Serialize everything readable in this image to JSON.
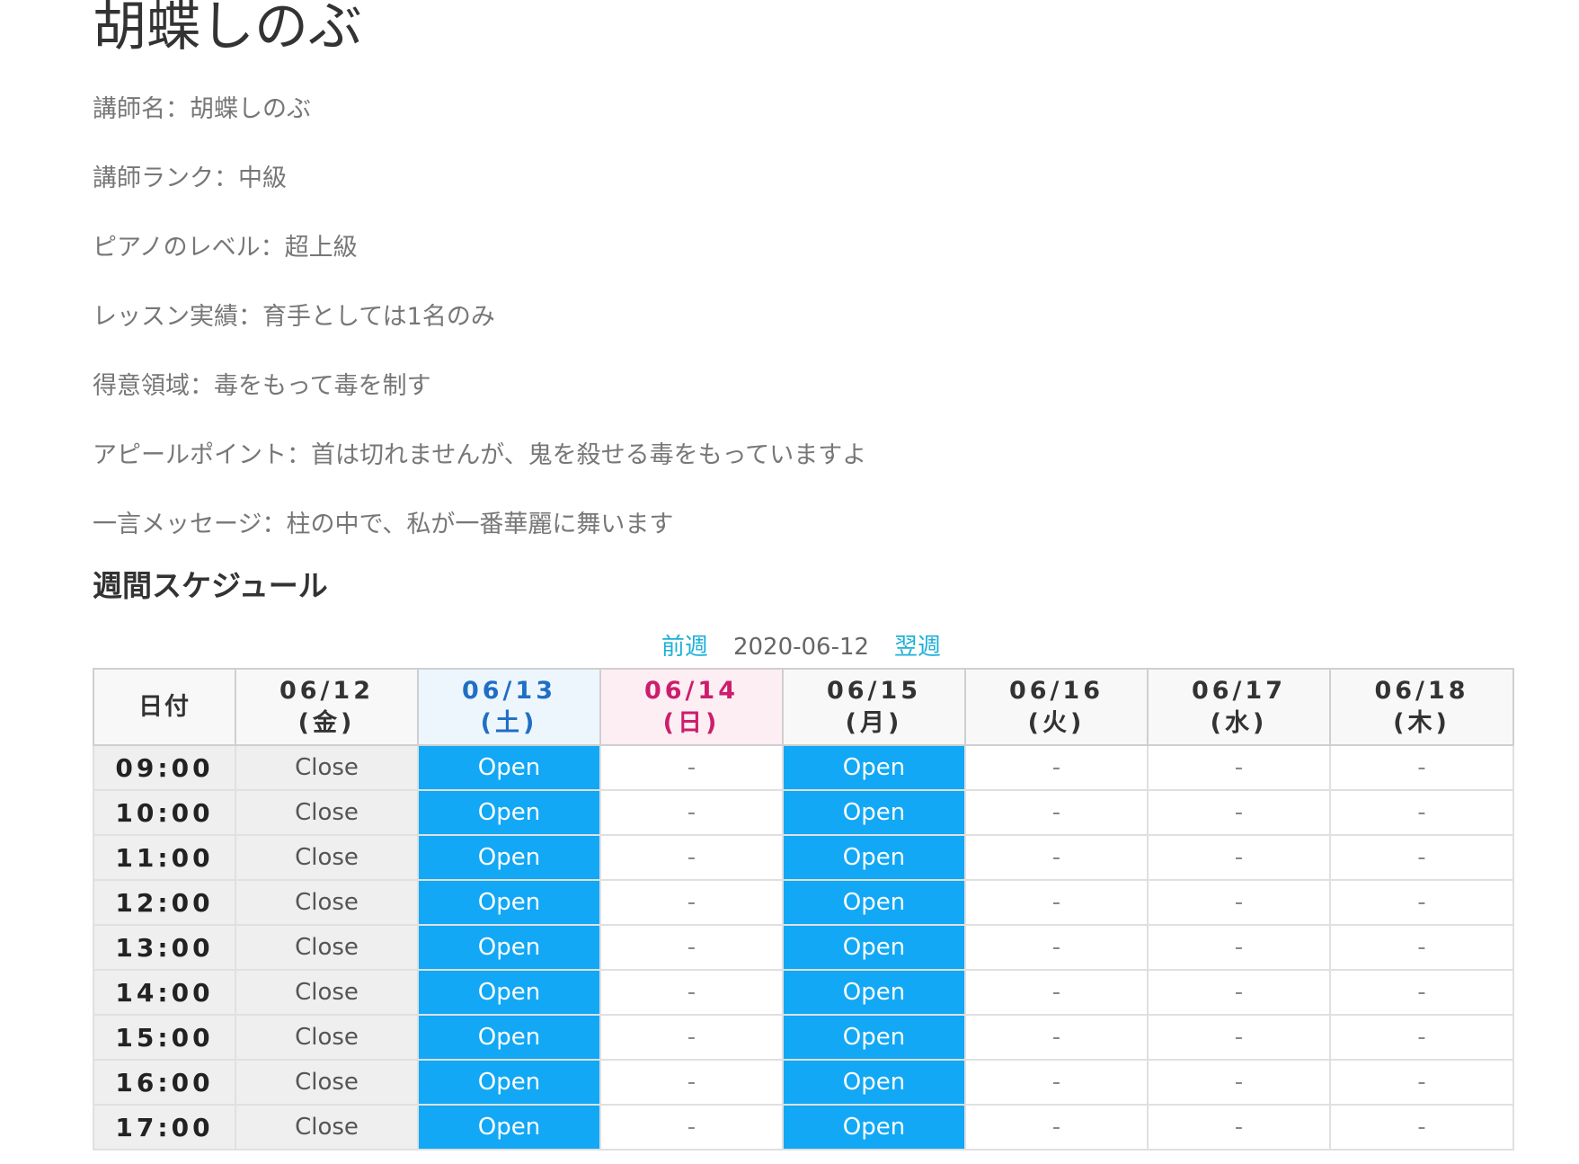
{
  "teacher": {
    "title": "胡蝶しのぶ",
    "profile": [
      "講師名：胡蝶しのぶ",
      "講師ランク：中級",
      "ピアノのレベル：超上級",
      "レッスン実績：育手としては1名のみ",
      "得意領域：毒をもって毒を制す",
      "アピールポイント：首は切れませんが、鬼を殺せる毒をもっていますよ",
      "一言メッセージ：柱の中で、私が一番華麗に舞います"
    ]
  },
  "schedule": {
    "section_title": "週間スケジュール",
    "nav": {
      "prev_label": "前週",
      "current_date": "2020-06-12",
      "next_label": "翌週"
    },
    "corner_label": "日付",
    "days": [
      {
        "date": "06/12",
        "weekday": "(金)",
        "kind": "weekday"
      },
      {
        "date": "06/13",
        "weekday": "(土)",
        "kind": "saturday"
      },
      {
        "date": "06/14",
        "weekday": "(日)",
        "kind": "sunday"
      },
      {
        "date": "06/15",
        "weekday": "(月)",
        "kind": "weekday"
      },
      {
        "date": "06/16",
        "weekday": "(火)",
        "kind": "weekday"
      },
      {
        "date": "06/17",
        "weekday": "(水)",
        "kind": "weekday"
      },
      {
        "date": "06/18",
        "weekday": "(木)",
        "kind": "weekday"
      }
    ],
    "rows": [
      {
        "time": "09:00",
        "cells": [
          "Close",
          "Open",
          "-",
          "Open",
          "-",
          "-",
          "-"
        ]
      },
      {
        "time": "10:00",
        "cells": [
          "Close",
          "Open",
          "-",
          "Open",
          "-",
          "-",
          "-"
        ]
      },
      {
        "time": "11:00",
        "cells": [
          "Close",
          "Open",
          "-",
          "Open",
          "-",
          "-",
          "-"
        ]
      },
      {
        "time": "12:00",
        "cells": [
          "Close",
          "Open",
          "-",
          "Open",
          "-",
          "-",
          "-"
        ]
      },
      {
        "time": "13:00",
        "cells": [
          "Close",
          "Open",
          "-",
          "Open",
          "-",
          "-",
          "-"
        ]
      },
      {
        "time": "14:00",
        "cells": [
          "Close",
          "Open",
          "-",
          "Open",
          "-",
          "-",
          "-"
        ]
      },
      {
        "time": "15:00",
        "cells": [
          "Close",
          "Open",
          "-",
          "Open",
          "-",
          "-",
          "-"
        ]
      },
      {
        "time": "16:00",
        "cells": [
          "Close",
          "Open",
          "-",
          "Open",
          "-",
          "-",
          "-"
        ]
      },
      {
        "time": "17:00",
        "cells": [
          "Close",
          "Open",
          "-",
          "Open",
          "-",
          "-",
          "-"
        ]
      }
    ],
    "colors": {
      "open": "#12a8f5",
      "close": "#efefef",
      "saturday": "#1f6fc4",
      "sunday": "#cc1e6c",
      "link": "#1fb0d8"
    }
  }
}
